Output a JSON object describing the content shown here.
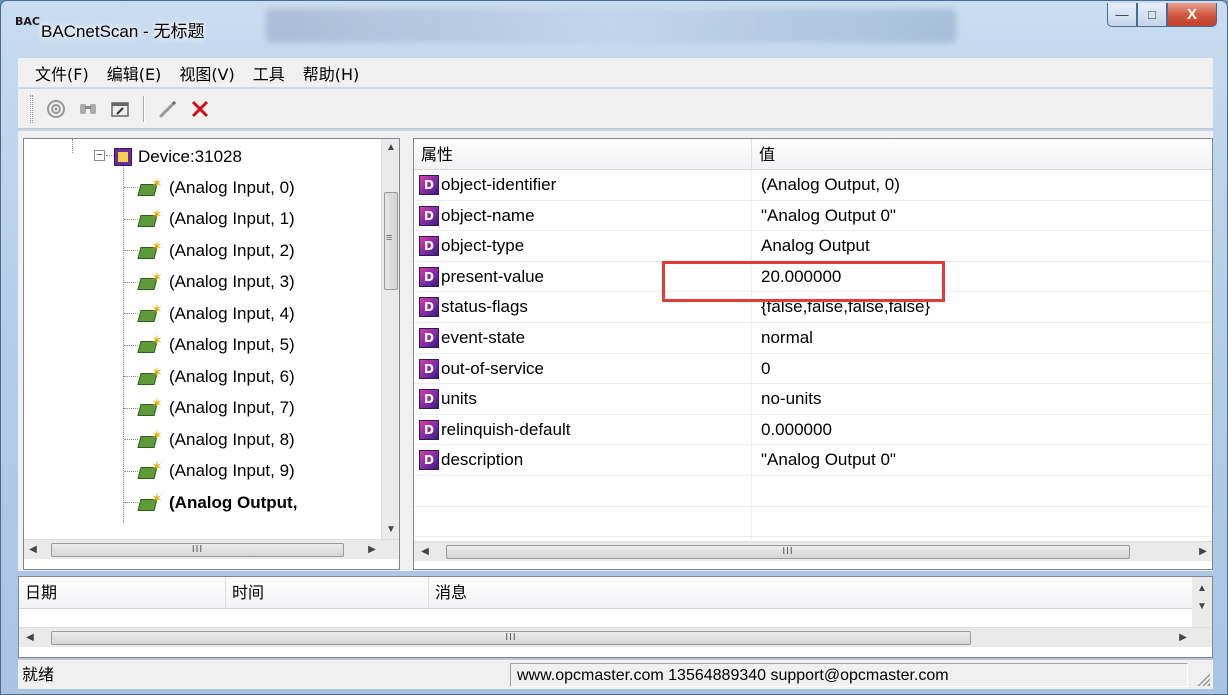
{
  "window": {
    "title": "BACnetScan - 无标题",
    "icon_text": "BAC",
    "controls": {
      "minimize": "—",
      "maximize": "□",
      "close": "X"
    }
  },
  "menu": [
    "文件(F)",
    "编辑(E)",
    "视图(V)",
    "工具",
    "帮助(H)"
  ],
  "toolbar": {
    "icons": [
      "discover-icon",
      "find-icon",
      "properties-icon",
      "edit-icon",
      "delete-icon"
    ]
  },
  "tree": {
    "device": {
      "label": "Device:31028",
      "expander": "−"
    },
    "objects": [
      "(Analog Input, 0)",
      "(Analog Input, 1)",
      "(Analog Input, 2)",
      "(Analog Input, 3)",
      "(Analog Input, 4)",
      "(Analog Input, 5)",
      "(Analog Input, 6)",
      "(Analog Input, 7)",
      "(Analog Input, 8)",
      "(Analog Input, 9)",
      "(Analog Output,"
    ],
    "selected_index": 10
  },
  "properties": {
    "columns": {
      "name": "属性",
      "value": "值"
    },
    "rows": [
      {
        "name": "object-identifier",
        "value": "(Analog Output, 0)"
      },
      {
        "name": "object-name",
        "value": "\"Analog Output 0\""
      },
      {
        "name": "object-type",
        "value": "Analog Output"
      },
      {
        "name": "present-value",
        "value": "20.000000"
      },
      {
        "name": "status-flags",
        "value": "{false,false,false,false}"
      },
      {
        "name": "event-state",
        "value": "normal"
      },
      {
        "name": "out-of-service",
        "value": "0"
      },
      {
        "name": "units",
        "value": "no-units"
      },
      {
        "name": "relinquish-default",
        "value": "0.000000"
      },
      {
        "name": "description",
        "value": "\"Analog Output 0\""
      }
    ],
    "icon_letter": "D",
    "highlighted_row": "present-value"
  },
  "log": {
    "columns": {
      "date": "日期",
      "time": "时间",
      "message": "消息"
    }
  },
  "scroll_glyph": "III",
  "status": {
    "ready": "就绪",
    "contact": "www.opcmaster.com 13564889340 support@opcmaster.com"
  },
  "colors": {
    "highlight_border": "#e53935",
    "close_button": "#c2402a"
  }
}
